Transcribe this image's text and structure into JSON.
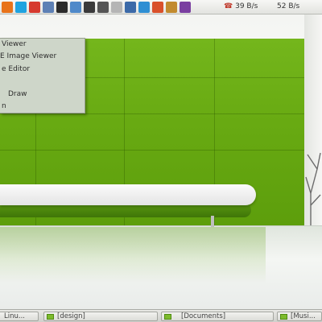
{
  "top_panel": {
    "icons": [
      {
        "name": "firefox-icon",
        "color": "#e8731a"
      },
      {
        "name": "skype-icon",
        "color": "#1fa3e0"
      },
      {
        "name": "opera-icon",
        "color": "#d63a2f"
      },
      {
        "name": "file-manager-icon",
        "color": "#5d80b5"
      },
      {
        "name": "terminal-icon",
        "color": "#2b2b2b"
      },
      {
        "name": "image-viewer-icon",
        "color": "#4f89c9"
      },
      {
        "name": "monitor-icon",
        "color": "#3a3a3a"
      },
      {
        "name": "home-icon",
        "color": "#555555"
      },
      {
        "name": "disk-icon",
        "color": "#b5b5b5"
      },
      {
        "name": "photo-editor-icon",
        "color": "#3c6aa8"
      },
      {
        "name": "globe-icon",
        "color": "#2f8fd3"
      },
      {
        "name": "fruit-icon",
        "color": "#d9502a"
      },
      {
        "name": "book-icon",
        "color": "#c28b2e"
      },
      {
        "name": "media-icon",
        "color": "#7a3fa0"
      }
    ],
    "network": {
      "down": "39 B/s",
      "up": "52 B/s"
    }
  },
  "menu": {
    "items": [
      {
        "label": "Viewer"
      },
      {
        "label": "E Image Viewer"
      },
      {
        "label": "e Editor"
      },
      {
        "label": ""
      },
      {
        "label": "Draw"
      },
      {
        "label": "n"
      }
    ]
  },
  "taskbar": {
    "tasks": [
      {
        "label": "Linu..."
      },
      {
        "label": "[design]"
      },
      {
        "label": "[Documents]"
      },
      {
        "label": "[Musi..."
      }
    ]
  },
  "colors": {
    "wall_green": "#6cad16",
    "menu_bg": "#ced6c9"
  }
}
